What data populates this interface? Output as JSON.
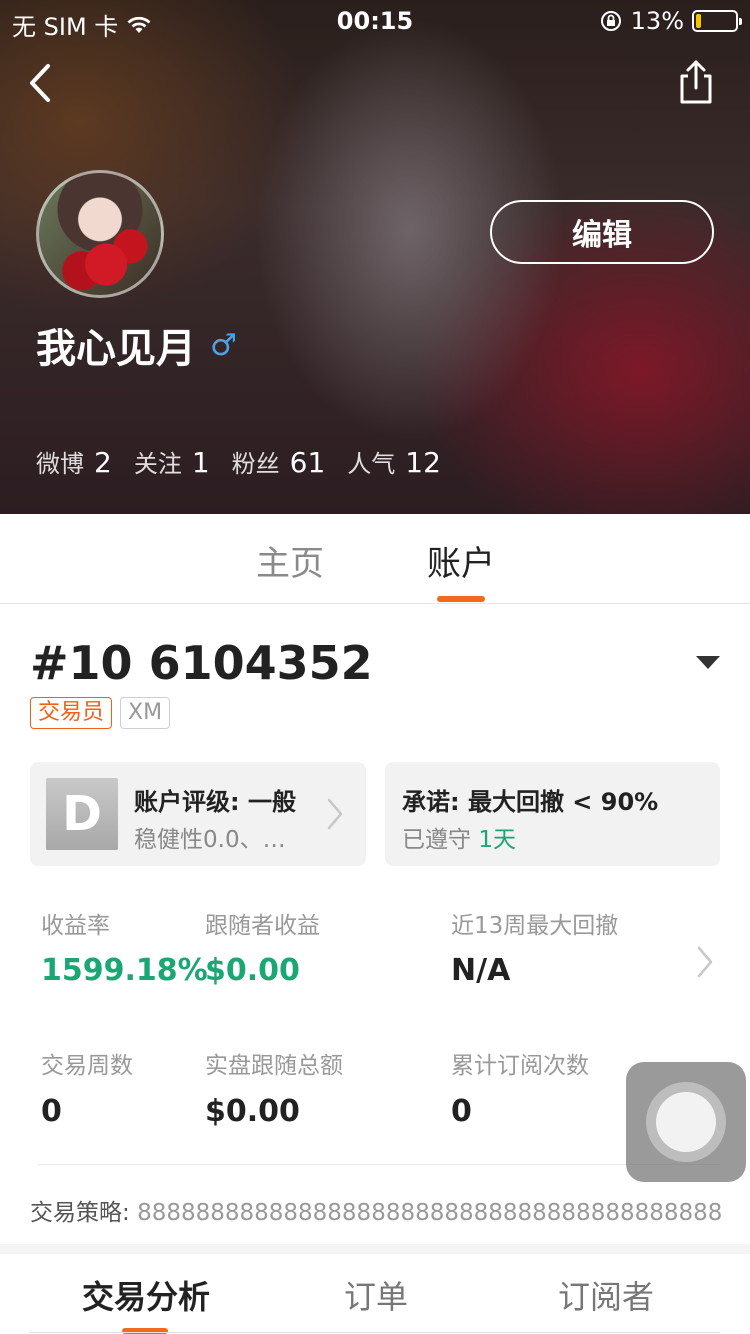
{
  "status_bar": {
    "carrier": "无 SIM 卡",
    "time": "00:15",
    "battery_percent": "13%",
    "battery_level": 0.13,
    "battery_color": "#f5c400"
  },
  "header": {
    "back_icon": "chevron-left-icon",
    "share_icon": "share-icon",
    "username": "我心见月",
    "gender_symbol": "♂",
    "edit_label": "编辑",
    "stats": [
      {
        "label": "微博",
        "value": "2"
      },
      {
        "label": "关注",
        "value": "1"
      },
      {
        "label": "粉丝",
        "value": "61"
      },
      {
        "label": "人气",
        "value": "12"
      }
    ]
  },
  "main_tabs": {
    "home": "主页",
    "account": "账户",
    "active": "账户"
  },
  "account": {
    "number": "#10 6104352",
    "tags": [
      "交易员",
      "XM"
    ],
    "rating_card": {
      "grade": "D",
      "title": "账户评级: 一般",
      "subtitle": "稳健性0.0、…"
    },
    "commit_card": {
      "title": "承诺: 最大回撤 < 90%",
      "subtitle_prefix": "已遵守",
      "subtitle_value": "1天"
    },
    "metrics_row1": [
      {
        "label": "收益率",
        "value": "1599.18%"
      },
      {
        "label": "跟随者收益",
        "value": "$0.00"
      },
      {
        "label": "近13周最大回撤",
        "value": "N/A"
      }
    ],
    "metrics_row2": [
      {
        "label": "交易周数",
        "value": "0"
      },
      {
        "label": "实盘跟随总额",
        "value": "$0.00"
      },
      {
        "label": "累计订阅次数",
        "value": "0"
      }
    ],
    "strategy_label": "交易策略:",
    "strategy_value": "8888888888888888888888888888888888888888"
  },
  "sub_tabs": [
    "交易分析",
    "订单",
    "订阅者"
  ],
  "colors": {
    "accent_orange": "#f26a1b",
    "positive_green": "#1aa774",
    "gender_blue": "#4aa3e8"
  }
}
